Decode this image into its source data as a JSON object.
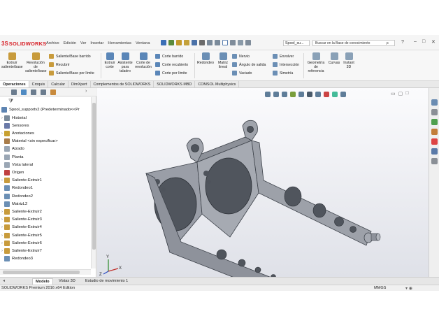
{
  "app": {
    "logo_mark": "3S",
    "logo_text": "SOLIDWORKS"
  },
  "menu": [
    "Archivo",
    "Edición",
    "Ver",
    "Insertar",
    "Herramientas",
    "Ventana"
  ],
  "title_tab": "Spool_su...",
  "search": {
    "placeholder": "Buscar en la Base de conocimiento"
  },
  "ribbon": {
    "buttons": [
      {
        "label": "Extruir saliente/base",
        "icon": "extrude-boss-icon"
      },
      {
        "label": "Revolución de saliente/base",
        "icon": "revolve-boss-icon"
      },
      {
        "label": "Extruir corte",
        "icon": "extrude-cut-icon"
      },
      {
        "label": "Asistente para taladro",
        "icon": "hole-wizard-icon"
      },
      {
        "label": "Corte de revolución",
        "icon": "revolve-cut-icon"
      },
      {
        "label": "Redondeo",
        "icon": "fillet-icon"
      },
      {
        "label": "Matriz lineal",
        "icon": "linear-pattern-icon"
      },
      {
        "label": "Geometría de referencia",
        "icon": "reference-geometry-icon"
      },
      {
        "label": "Curvas",
        "icon": "curves-icon"
      },
      {
        "label": "Instant 3D",
        "icon": "instant3d-icon"
      }
    ],
    "small": [
      {
        "label": "Saliente/Base barrido",
        "icon": "sweep-boss-icon"
      },
      {
        "label": "Recubrir",
        "icon": "loft-icon"
      },
      {
        "label": "Saliente/Base por límite",
        "icon": "boundary-boss-icon"
      },
      {
        "label": "Corte barrido",
        "icon": "swept-cut-icon"
      },
      {
        "label": "Corte recubierto",
        "icon": "lofted-cut-icon"
      },
      {
        "label": "Corte por límite",
        "icon": "boundary-cut-icon"
      },
      {
        "label": "Nervio",
        "icon": "rib-icon"
      },
      {
        "label": "Ángulo de salida",
        "icon": "draft-icon"
      },
      {
        "label": "Vaciado",
        "icon": "shell-icon"
      },
      {
        "label": "Envolver",
        "icon": "wrap-icon"
      },
      {
        "label": "Intersección",
        "icon": "intersect-icon"
      },
      {
        "label": "Simetría",
        "icon": "mirror-icon"
      }
    ]
  },
  "cm_tabs": [
    "Operaciones",
    "Croquis",
    "Calcular",
    "DimXpert",
    "Complementos de SOLIDWORKS",
    "SOLIDWORKS MBD",
    "COMSOL Multiphysics"
  ],
  "tree": {
    "root": "Spool_supportv2  (Predeterminado<<Pr",
    "items": [
      {
        "label": "Historial",
        "icon": "history-icon",
        "exp": "›"
      },
      {
        "label": "Sensores",
        "icon": "sensors-icon",
        "exp": ""
      },
      {
        "label": "Anotaciones",
        "icon": "annotations-icon",
        "exp": "›"
      },
      {
        "label": "Material <sin especificar>",
        "icon": "material-icon",
        "exp": ""
      },
      {
        "label": "Alzado",
        "icon": "plane-icon",
        "exp": ""
      },
      {
        "label": "Planta",
        "icon": "plane-icon",
        "exp": ""
      },
      {
        "label": "Vista lateral",
        "icon": "plane-icon",
        "exp": ""
      },
      {
        "label": "Origen",
        "icon": "origin-icon",
        "exp": ""
      },
      {
        "label": "Saliente-Extruir1",
        "icon": "extrude-feature-icon",
        "exp": "›"
      },
      {
        "label": "Redondeo1",
        "icon": "fillet-feature-icon",
        "exp": ""
      },
      {
        "label": "Redondeo2",
        "icon": "fillet-feature-icon",
        "exp": ""
      },
      {
        "label": "MatrizL2",
        "icon": "pattern-feature-icon",
        "exp": ""
      },
      {
        "label": "Saliente-Extruir2",
        "icon": "extrude-feature-icon",
        "exp": "›"
      },
      {
        "label": "Saliente-Extruir3",
        "icon": "extrude-feature-icon",
        "exp": "›"
      },
      {
        "label": "Saliente-Extruir4",
        "icon": "extrude-feature-icon",
        "exp": "›"
      },
      {
        "label": "Saliente-Extruir5",
        "icon": "extrude-feature-icon",
        "exp": "›"
      },
      {
        "label": "Saliente-Extruir6",
        "icon": "extrude-feature-icon",
        "exp": "›"
      },
      {
        "label": "Saliente-Extruir7",
        "icon": "extrude-feature-icon",
        "exp": "›"
      },
      {
        "label": "Redondeo3",
        "icon": "fillet-feature-icon",
        "exp": ""
      }
    ]
  },
  "triad": {
    "x": "X",
    "y": "Y",
    "z": "Z"
  },
  "bottom_tabs": [
    "Modelo",
    "Vistas 3D",
    "Estudio de movimiento 1"
  ],
  "status": {
    "edition": "SOLIDWORKS Premium 2016 x64 Edition",
    "units": "MMGS"
  },
  "colors": {
    "brand": "#d71f26",
    "part_face": "#9a9ea7",
    "part_dark": "#4d525b",
    "viewport_top": "#fbfbfd",
    "viewport_bottom": "#dfe1e8"
  }
}
